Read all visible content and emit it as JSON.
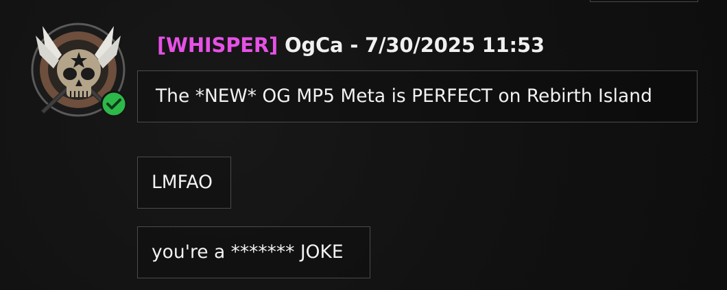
{
  "chat": {
    "message_group": {
      "avatar_icon": "skull-emblem-icon",
      "status_icon": "online-check-icon",
      "whisper_tag": "[WHISPER]",
      "sender_line": "OgCa - 7/30/2025 11:53",
      "messages": [
        "The *NEW* OG MP5 Meta is PERFECT on Rebirth Island",
        "LMFAO",
        "you're a ******* JOKE"
      ]
    }
  },
  "colors": {
    "background": "#111111",
    "whisper": "#e651e6",
    "text": "#f2f2f2",
    "bubble_border": "#4c4c4c",
    "online": "#2db84a"
  }
}
